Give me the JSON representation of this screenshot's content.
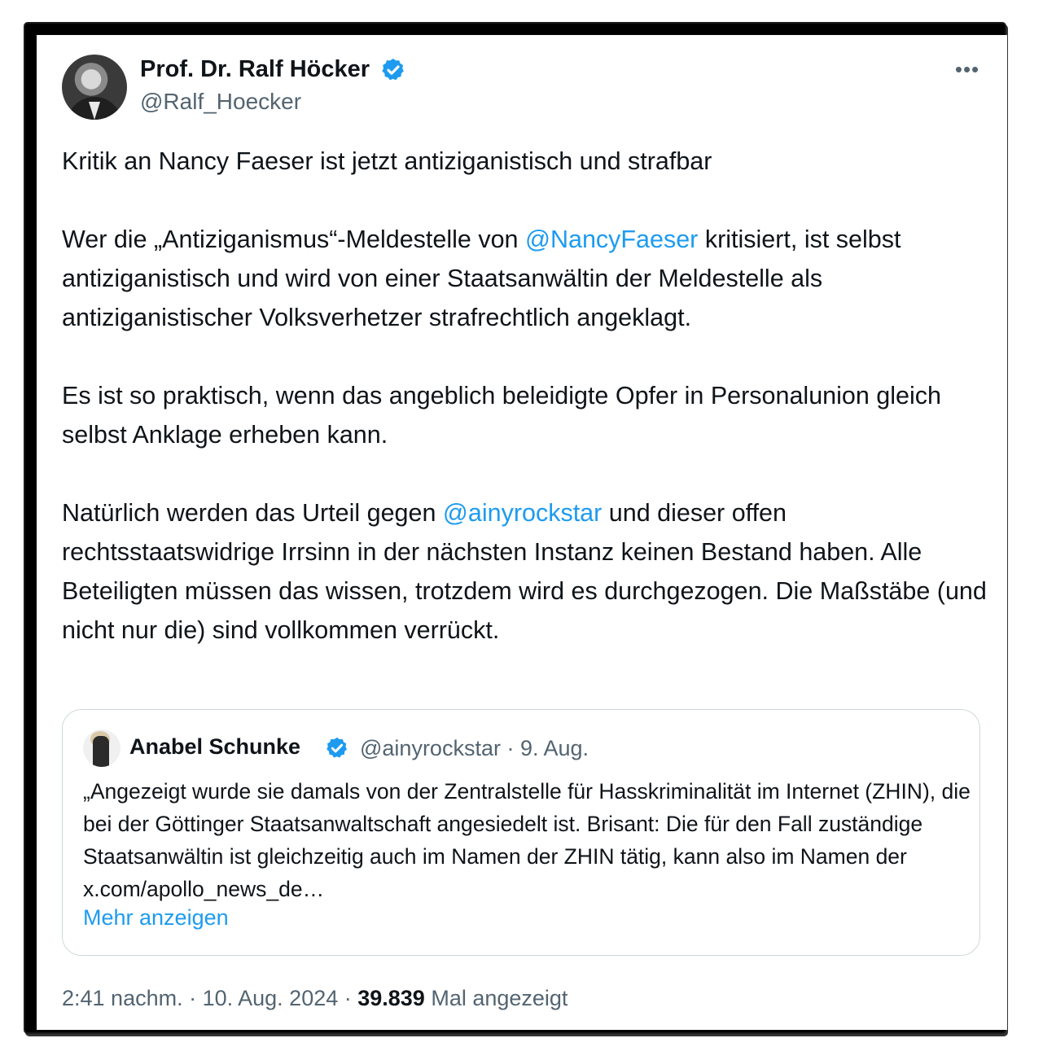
{
  "author": {
    "name": "Prof. Dr. Ralf Höcker",
    "handle": "@Ralf_Hoecker",
    "verified_icon": "verified-badge-icon",
    "verified_color": "#1d9bf0"
  },
  "menu": {
    "more_label": "•••"
  },
  "post": {
    "p1": "Kritik an Nancy Faeser ist jetzt antiziganistisch und strafbar",
    "p2_before": "Wer die „Antiziganismus“-Meldestelle von ",
    "p2_mention": "@NancyFaeser",
    "p2_after": " kritisiert, ist selbst antiziganistisch und wird von einer Staatsanwältin der Meldestelle als antiziganistischer Volksverhetzer strafrechtlich angeklagt.",
    "p3": "Es ist so praktisch, wenn das angeblich beleidigte Opfer in Personalunion gleich selbst Anklage erheben kann.",
    "p4_before": "Natürlich werden das Urteil gegen ",
    "p4_mention": "@ainyrockstar",
    "p4_after": " und dieser offen rechtsstaatswidrige Irrsinn in der nächsten Instanz keinen Bestand haben. Alle Beteiligten müssen das wissen, trotzdem wird es durchgezogen. Die Maßstäbe (und nicht nur die) sind vollkommen verrückt."
  },
  "quote": {
    "name": "Anabel Schunke",
    "meta": "@ainyrockstar · 9. Aug.",
    "text": "„Angezeigt wurde sie damals von der Zentralstelle für Hasskriminalität im Internet (ZHIN), die bei der Göttinger Staatsanwaltschaft angesiedelt ist. Brisant: Die für den Fall zuständige Staatsanwältin ist gleichzeitig auch im Namen der ZHIN tätig, kann also im Namen der x.com/apollo_news_de…",
    "show_more": "Mehr anzeigen"
  },
  "footer": {
    "time_date": "2:41 nachm. · 10. Aug. 2024 · ",
    "views": "39.839",
    "views_label": " Mal angezeigt"
  },
  "colors": {
    "link": "#1d9bf0",
    "text": "#0f1419",
    "secondary": "#536471",
    "frame": "#000000"
  }
}
